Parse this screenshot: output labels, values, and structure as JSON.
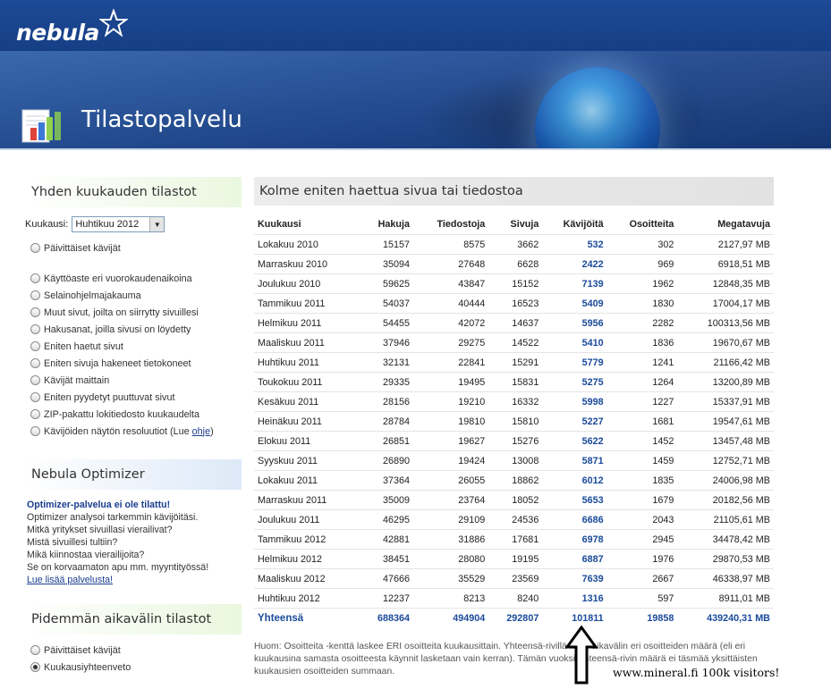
{
  "header": {
    "logo_text": "nebula",
    "title": "Tilastopalvelu"
  },
  "sidebar": {
    "monthly_title": "Yhden kuukauden tilastot",
    "month_label": "Kuukausi:",
    "month_selected": "Huhtikuu 2012",
    "daily_visitors": "Päivittäiset kävijät",
    "options": [
      "Käyttöaste eri vuorokaudenaikoina",
      "Selainohjelmajakauma",
      "Muut sivut, joilta on siirrytty sivuillesi",
      "Hakusanat, joilla sivusi on löydetty",
      "Eniten haetut sivut",
      "Eniten sivuja hakeneet tietokoneet",
      "Kävijät maittain",
      "Eniten pyydetyt puuttuvat sivut",
      "ZIP-pakattu lokitiedosto kuukaudelta"
    ],
    "resolution_text": "Kävijöiden näytön resoluutiot (Lue ",
    "resolution_link": "ohje",
    "resolution_end": ")",
    "optimizer_title": "Nebula Optimizer",
    "optimizer_lines": [
      "Optimizer-palvelua ei ole tilattu!",
      "Optimizer analysoi tarkemmin kävijöitäsi.",
      "Mitkä yritykset sivuillasi vierailivat?",
      "Mistä sivuillesi tultiin?",
      "Mikä kiinnostaa vierailijoita?",
      "Se on korvaamaton apu mm. myyntityössä!"
    ],
    "optimizer_link": "Lue lisää palvelusta!",
    "long_title": "Pidemmän aikavälin tilastot",
    "long_options": [
      "Päivittäiset kävijät",
      "Kuukausiyhteenveto"
    ]
  },
  "main": {
    "title": "Kolme eniten haettua sivua tai tiedostoa",
    "columns": [
      "Kuukausi",
      "Hakuja",
      "Tiedostoja",
      "Sivuja",
      "Kävijöitä",
      "Osoitteita",
      "Megatavuja"
    ],
    "rows": [
      [
        "Lokakuu 2010",
        "15157",
        "8575",
        "3662",
        "532",
        "302",
        "2127,97 MB"
      ],
      [
        "Marraskuu 2010",
        "35094",
        "27648",
        "6628",
        "2422",
        "969",
        "6918,51 MB"
      ],
      [
        "Joulukuu 2010",
        "59625",
        "43847",
        "15152",
        "7139",
        "1962",
        "12848,35 MB"
      ],
      [
        "Tammikuu 2011",
        "54037",
        "40444",
        "16523",
        "5409",
        "1830",
        "17004,17 MB"
      ],
      [
        "Helmikuu 2011",
        "54455",
        "42072",
        "14637",
        "5956",
        "2282",
        "100313,56 MB"
      ],
      [
        "Maaliskuu 2011",
        "37946",
        "29275",
        "14522",
        "5410",
        "1836",
        "19670,67 MB"
      ],
      [
        "Huhtikuu 2011",
        "32131",
        "22841",
        "15291",
        "5779",
        "1241",
        "21166,42 MB"
      ],
      [
        "Toukokuu 2011",
        "29335",
        "19495",
        "15831",
        "5275",
        "1264",
        "13200,89 MB"
      ],
      [
        "Kesäkuu 2011",
        "28156",
        "19210",
        "16332",
        "5998",
        "1227",
        "15337,91 MB"
      ],
      [
        "Heinäkuu 2011",
        "28784",
        "19810",
        "15810",
        "5227",
        "1681",
        "19547,61 MB"
      ],
      [
        "Elokuu 2011",
        "26851",
        "19627",
        "15276",
        "5622",
        "1452",
        "13457,48 MB"
      ],
      [
        "Syyskuu 2011",
        "26890",
        "19424",
        "13008",
        "5871",
        "1459",
        "12752,71 MB"
      ],
      [
        "Lokakuu 2011",
        "37364",
        "26055",
        "18862",
        "6012",
        "1835",
        "24006,98 MB"
      ],
      [
        "Marraskuu 2011",
        "35009",
        "23764",
        "18052",
        "5653",
        "1679",
        "20182,56 MB"
      ],
      [
        "Joulukuu 2011",
        "46295",
        "29109",
        "24536",
        "6686",
        "2043",
        "21105,61 MB"
      ],
      [
        "Tammikuu 2012",
        "42881",
        "31886",
        "17681",
        "6978",
        "2945",
        "34478,42 MB"
      ],
      [
        "Helmikuu 2012",
        "38451",
        "28080",
        "19195",
        "6887",
        "1976",
        "29870,53 MB"
      ],
      [
        "Maaliskuu 2012",
        "47666",
        "35529",
        "23569",
        "7639",
        "2667",
        "46338,97 MB"
      ],
      [
        "Huhtikuu 2012",
        "12237",
        "8213",
        "8240",
        "1316",
        "597",
        "8911,01 MB"
      ]
    ],
    "total": [
      "Yhteensä",
      "688364",
      "494904",
      "292807",
      "101811",
      "19858",
      "439240,31 MB"
    ],
    "note": "Huom: Osoitteita -kenttä laskee ERI osoitteita kuukausittain. Yhteensä-rivillä koko aikavälin eri osoitteiden määrä (eli eri kuukausina samasta osoitteesta käynnit lasketaan vain kerran). Tämän vuoksi Yhteensä-rivin määrä ei täsmää yksittäisten kuukausien osoitteiden summaan."
  },
  "annotation": {
    "text": "www.mineral.fi 100k visitors!"
  }
}
